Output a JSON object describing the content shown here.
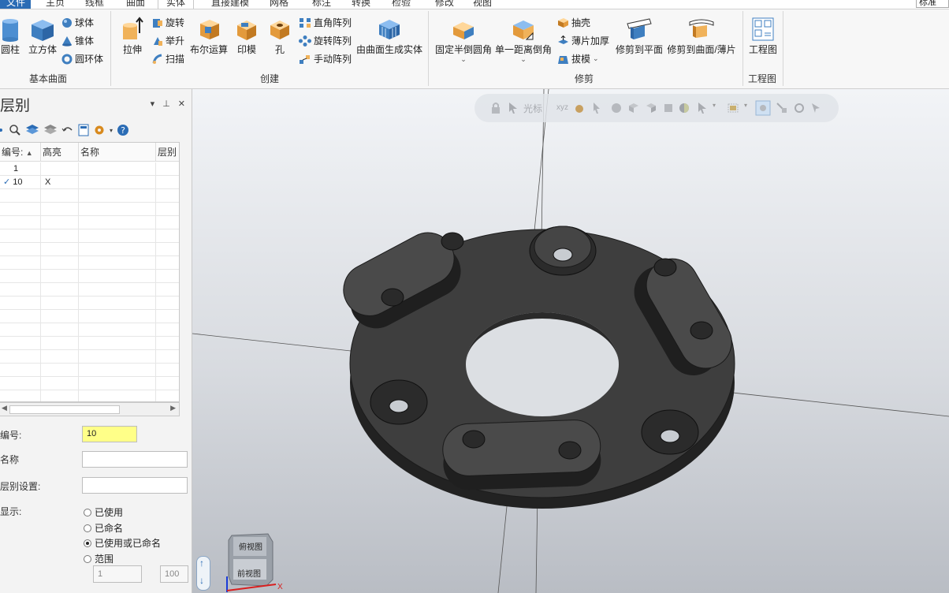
{
  "tabs": {
    "file": "文件",
    "home": "主页",
    "wireframe": "线框",
    "surface": "曲面",
    "solid": "实体",
    "direct": "直接建模",
    "mesh": "网格",
    "annotate": "标注",
    "convert": "转换",
    "inspect": "检验",
    "tools": "修改",
    "view": "视图",
    "corner": "标准"
  },
  "ribbon": {
    "groups": {
      "basic": "基本曲面",
      "create": "创建",
      "modify": "修剪",
      "drawing": "工程图"
    },
    "basic": {
      "cylinder": "圆柱",
      "cube": "立方体",
      "sphere": "球体",
      "cone": "锥体",
      "torus": "圆环体"
    },
    "create": {
      "extrude": "拉伸",
      "revolve": "旋转",
      "loft": "举升",
      "sweep": "扫描",
      "boolean": "布尔运算",
      "imprint": "印模",
      "hole": "孔",
      "rect_array": "直角阵列",
      "rot_array": "旋转阵列",
      "manual_array": "手动阵列",
      "surface_to_solid": "由曲面生成实体"
    },
    "modify": {
      "fixed_fillet": "固定半倒圆角",
      "chamfer": "单一距离倒角",
      "shell": "抽壳",
      "thicken": "薄片加厚",
      "draft": "拔模",
      "trim_plane": "修剪到平面",
      "trim_surface": "修剪到曲面/薄片"
    },
    "drawing": {
      "drawing": "工程图"
    }
  },
  "panel": {
    "title": "层别",
    "columns": [
      "编号:",
      "高亮",
      "名称",
      "层别"
    ],
    "rows": [
      {
        "no": "1",
        "highlight": "",
        "name": "",
        "checked": false
      },
      {
        "no": "10",
        "highlight": "X",
        "name": "",
        "checked": true
      }
    ],
    "number_label": "编号:",
    "number_value": "10",
    "name_label": "名称",
    "name_value": "",
    "setting_label": "层别设置:",
    "setting_value": "",
    "display_label": "显示:",
    "radios": [
      {
        "label": "已使用",
        "selected": false
      },
      {
        "label": "已命名",
        "selected": false
      },
      {
        "label": "已使用或已命名",
        "selected": true
      },
      {
        "label": "范围",
        "selected": false
      }
    ],
    "range_from": "1",
    "range_to": "100"
  },
  "viewport": {
    "cursor_label": "光标",
    "cursor_xyz": "xyz",
    "viewcube_top": "俯视图",
    "viewcube_front": "前视图",
    "axis_x": "X"
  },
  "colors": {
    "accent": "#2b6cb5",
    "highlight_input": "#ffff88",
    "part": "#3d3d3d"
  }
}
